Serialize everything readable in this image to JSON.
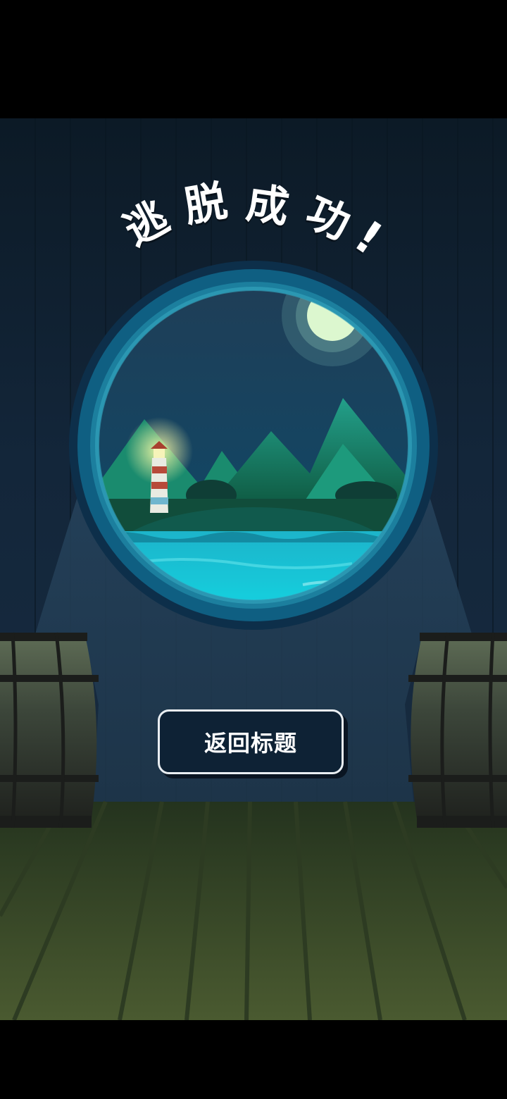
{
  "screen": {
    "title": "逃脱成功!",
    "title_chars": [
      "逃",
      "脱",
      "成",
      "功",
      "!"
    ],
    "button_label": "返回标题"
  },
  "colors": {
    "wall": "#13263a",
    "floor": "#3f4f2c",
    "porthole_rim": "#0f5f82",
    "sea": "#18c9d8",
    "moon": "#dcf7cf",
    "button_border": "#e9eef2"
  }
}
